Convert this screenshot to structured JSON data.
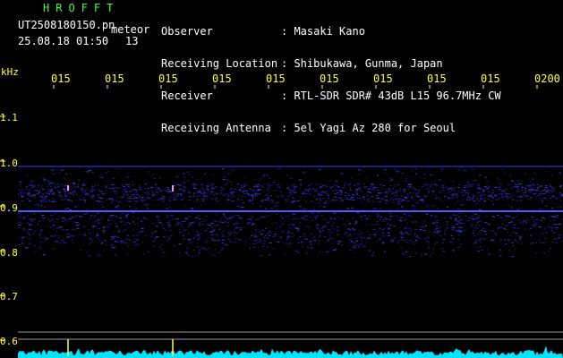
{
  "header": {
    "title": "HROFFT",
    "filename": "UT2508180150.pn",
    "tag": "meteor",
    "datetime": "25.08.18 01:50",
    "count": "13"
  },
  "meta": [
    {
      "key": "Observer",
      "value": ": Masaki Kano"
    },
    {
      "key": "Receiving Location",
      "value": ": Shibukawa, Gunma, Japan"
    },
    {
      "key": "Receiver",
      "value": ": RTL-SDR SDR# 43dB L15 96.7MHz CW"
    },
    {
      "key": "Receiving Antenna",
      "value": ": 5el Yagi Az 280 for Seoul"
    }
  ],
  "axis": {
    "unit": "kHz",
    "y_labels": [
      "1.1",
      "1.0",
      "0.9",
      "0.8",
      "0.7",
      "0.6"
    ],
    "x_labels": [
      "015",
      "015",
      "015",
      "015",
      "015",
      "015",
      "015",
      "015",
      "015",
      "0200"
    ]
  },
  "colors": {
    "title": "#3cff3c",
    "text": "#ffffff",
    "axis": "#ffff3a",
    "signal": "#4a4aff",
    "baseline": "#00e5ff",
    "meteor": "#ff8cff"
  }
}
